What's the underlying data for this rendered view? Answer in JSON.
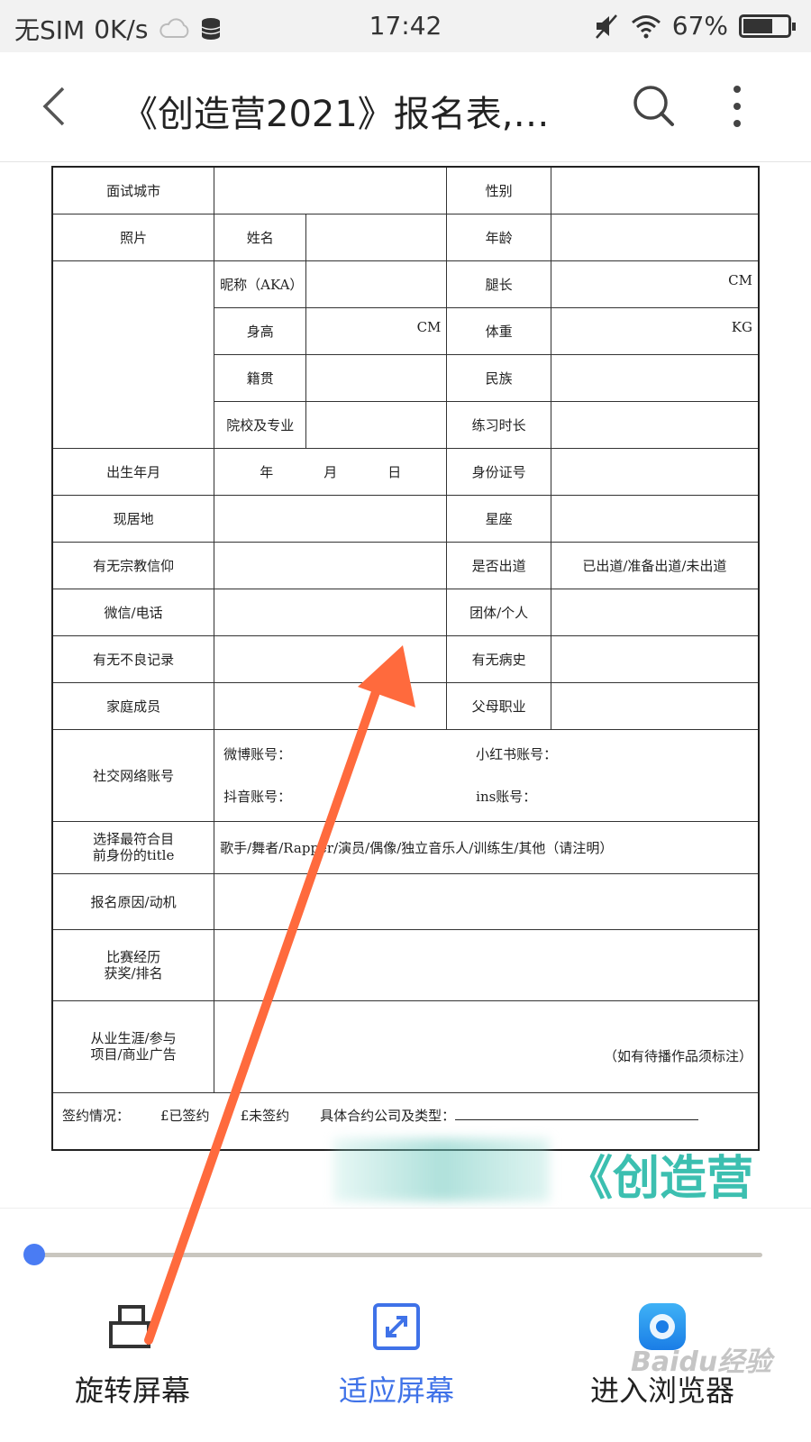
{
  "status_bar": {
    "carrier": "无SIM",
    "network_speed": "0K/s",
    "time": "17:42",
    "battery": "67%",
    "battery_level": 0.67
  },
  "header": {
    "title": "《创造营2021》报名表,…",
    "back_icon": "chevron-left-icon",
    "search_icon": "search-icon",
    "more_icon": "more-vertical-icon"
  },
  "form": {
    "interview_city": "面试城市",
    "gender": "性别",
    "photo": "照片",
    "name": "姓名",
    "age": "年龄",
    "nickname": "昵称（AKA）",
    "leg_length": "腿长",
    "cm_unit": "CM",
    "height": "身高",
    "height_unit": "CM",
    "weight": "体重",
    "kg_unit": "KG",
    "native_place": "籍贯",
    "ethnicity": "民族",
    "school": "院校及专业",
    "practice_time": "练习时长",
    "birth_date": "出生年月",
    "year": "年",
    "month": "月",
    "day": "日",
    "id_number": "身份证号",
    "residence": "现居地",
    "constellation": "星座",
    "religion": "有无宗教信仰",
    "debuted": "是否出道",
    "debut_options": "已出道/准备出道/未出道",
    "contact": "微信/电话",
    "group_individual": "团体/个人",
    "bad_record": "有无不良记录",
    "medical_history": "有无病史",
    "family": "家庭成员",
    "parents_job": "父母职业",
    "social_accounts": "社交网络账号",
    "weibo": "微博账号：",
    "xiaohongshu": "小红书账号：",
    "douyin": "抖音账号：",
    "ins": "ins账号：",
    "identity_label_1": "选择最符合目",
    "identity_label_2": "前身份的title",
    "identity_options": "歌手/舞者/Rapper/演员/偶像/独立音乐人/训练生/其他（请注明）",
    "motivation": "报名原因/动机",
    "competition_1": "比赛经历",
    "competition_2": "获奖/排名",
    "career_1": "从业生涯/参与",
    "career_2": "项目/商业广告",
    "career_note": "（如有待播作品须标注）",
    "contract_label": "签约情况：",
    "signed": "£已签约",
    "unsigned": "£未签约",
    "contract_company": "具体合约公司及类型："
  },
  "banner": {
    "text": "《创造营"
  },
  "slider": {
    "value": 0.0
  },
  "toolbar": {
    "rotate": "旋转屏幕",
    "fit": "适应屏幕",
    "browser": "进入浏览器"
  },
  "watermark": "Baidu经验",
  "colors": {
    "accent": "#3f72e8",
    "arrow": "#ff6a3d",
    "banner": "#3cbfb0"
  }
}
